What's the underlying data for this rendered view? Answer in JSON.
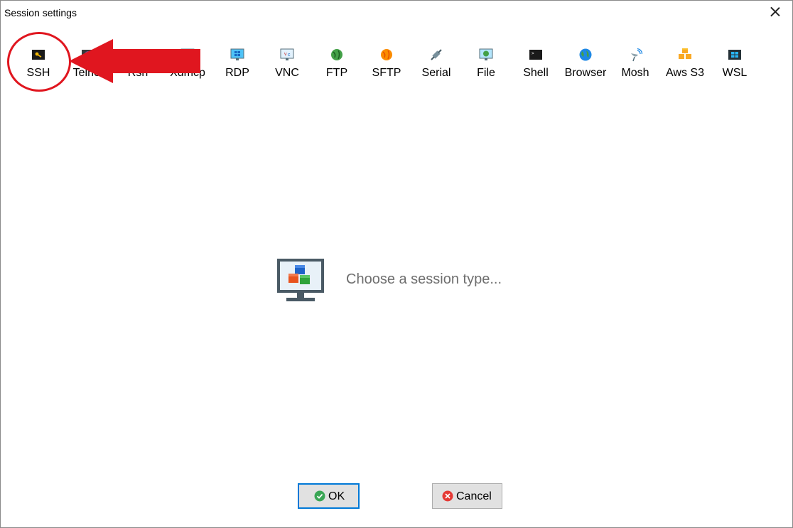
{
  "window": {
    "title": "Session settings"
  },
  "session_types": [
    {
      "label": "SSH",
      "icon": "ssh-key-icon"
    },
    {
      "label": "Telnet",
      "icon": "telnet-icon"
    },
    {
      "label": "Rsh",
      "icon": "rsh-icon"
    },
    {
      "label": "Xdmcp",
      "icon": "xdmcp-monitor-icon"
    },
    {
      "label": "RDP",
      "icon": "rdp-windows-monitor-icon"
    },
    {
      "label": "VNC",
      "icon": "vnc-monitor-icon"
    },
    {
      "label": "FTP",
      "icon": "ftp-globe-icon"
    },
    {
      "label": "SFTP",
      "icon": "sftp-globe-icon"
    },
    {
      "label": "Serial",
      "icon": "serial-plug-icon"
    },
    {
      "label": "File",
      "icon": "file-monitor-icon"
    },
    {
      "label": "Shell",
      "icon": "shell-terminal-icon"
    },
    {
      "label": "Browser",
      "icon": "browser-globe-icon"
    },
    {
      "label": "Mosh",
      "icon": "mosh-satellite-icon"
    },
    {
      "label": "Aws S3",
      "icon": "aws-s3-cubes-icon"
    },
    {
      "label": "WSL",
      "icon": "wsl-windows-icon"
    }
  ],
  "main": {
    "placeholder_text": "Choose a session type..."
  },
  "buttons": {
    "ok_label": "OK",
    "cancel_label": "Cancel"
  },
  "colors": {
    "annotation_red": "#e0161f",
    "focus_blue": "#0078d7",
    "ok_green": "#3aa655",
    "cancel_red": "#e53935"
  }
}
